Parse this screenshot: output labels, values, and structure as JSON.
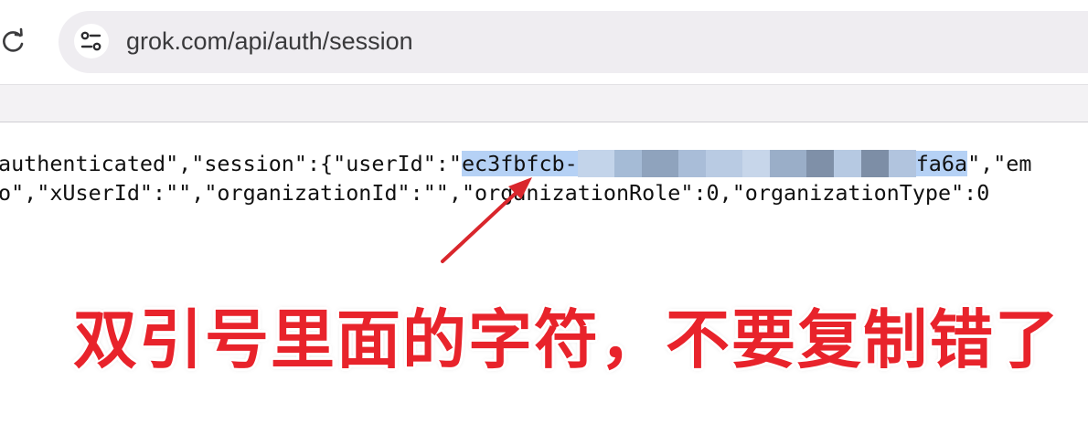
{
  "browser": {
    "url": "grok.com/api/auth/session",
    "reload_icon": "reload-icon",
    "site_info_icon": "tune-icon"
  },
  "json_text": {
    "line1_before": "authenticated\",\"session\":{\"userId\":\"",
    "user_id_start": "ec3fbfcb-",
    "user_id_end": "fa6a",
    "line1_after": "\",\"em",
    "line2": "o\",\"xUserId\":\"\",\"organizationId\":\"\",\"organizationRole\":0,\"organizationType\":0"
  },
  "annotation": {
    "text": "双引号里面的字符，不要复制错了",
    "color": "#e8232b",
    "arrow_icon": "arrow-icon"
  },
  "colors": {
    "selection": "#b5d1f5",
    "omnibox": "#efedf1",
    "annotation_red": "#e8232b"
  }
}
